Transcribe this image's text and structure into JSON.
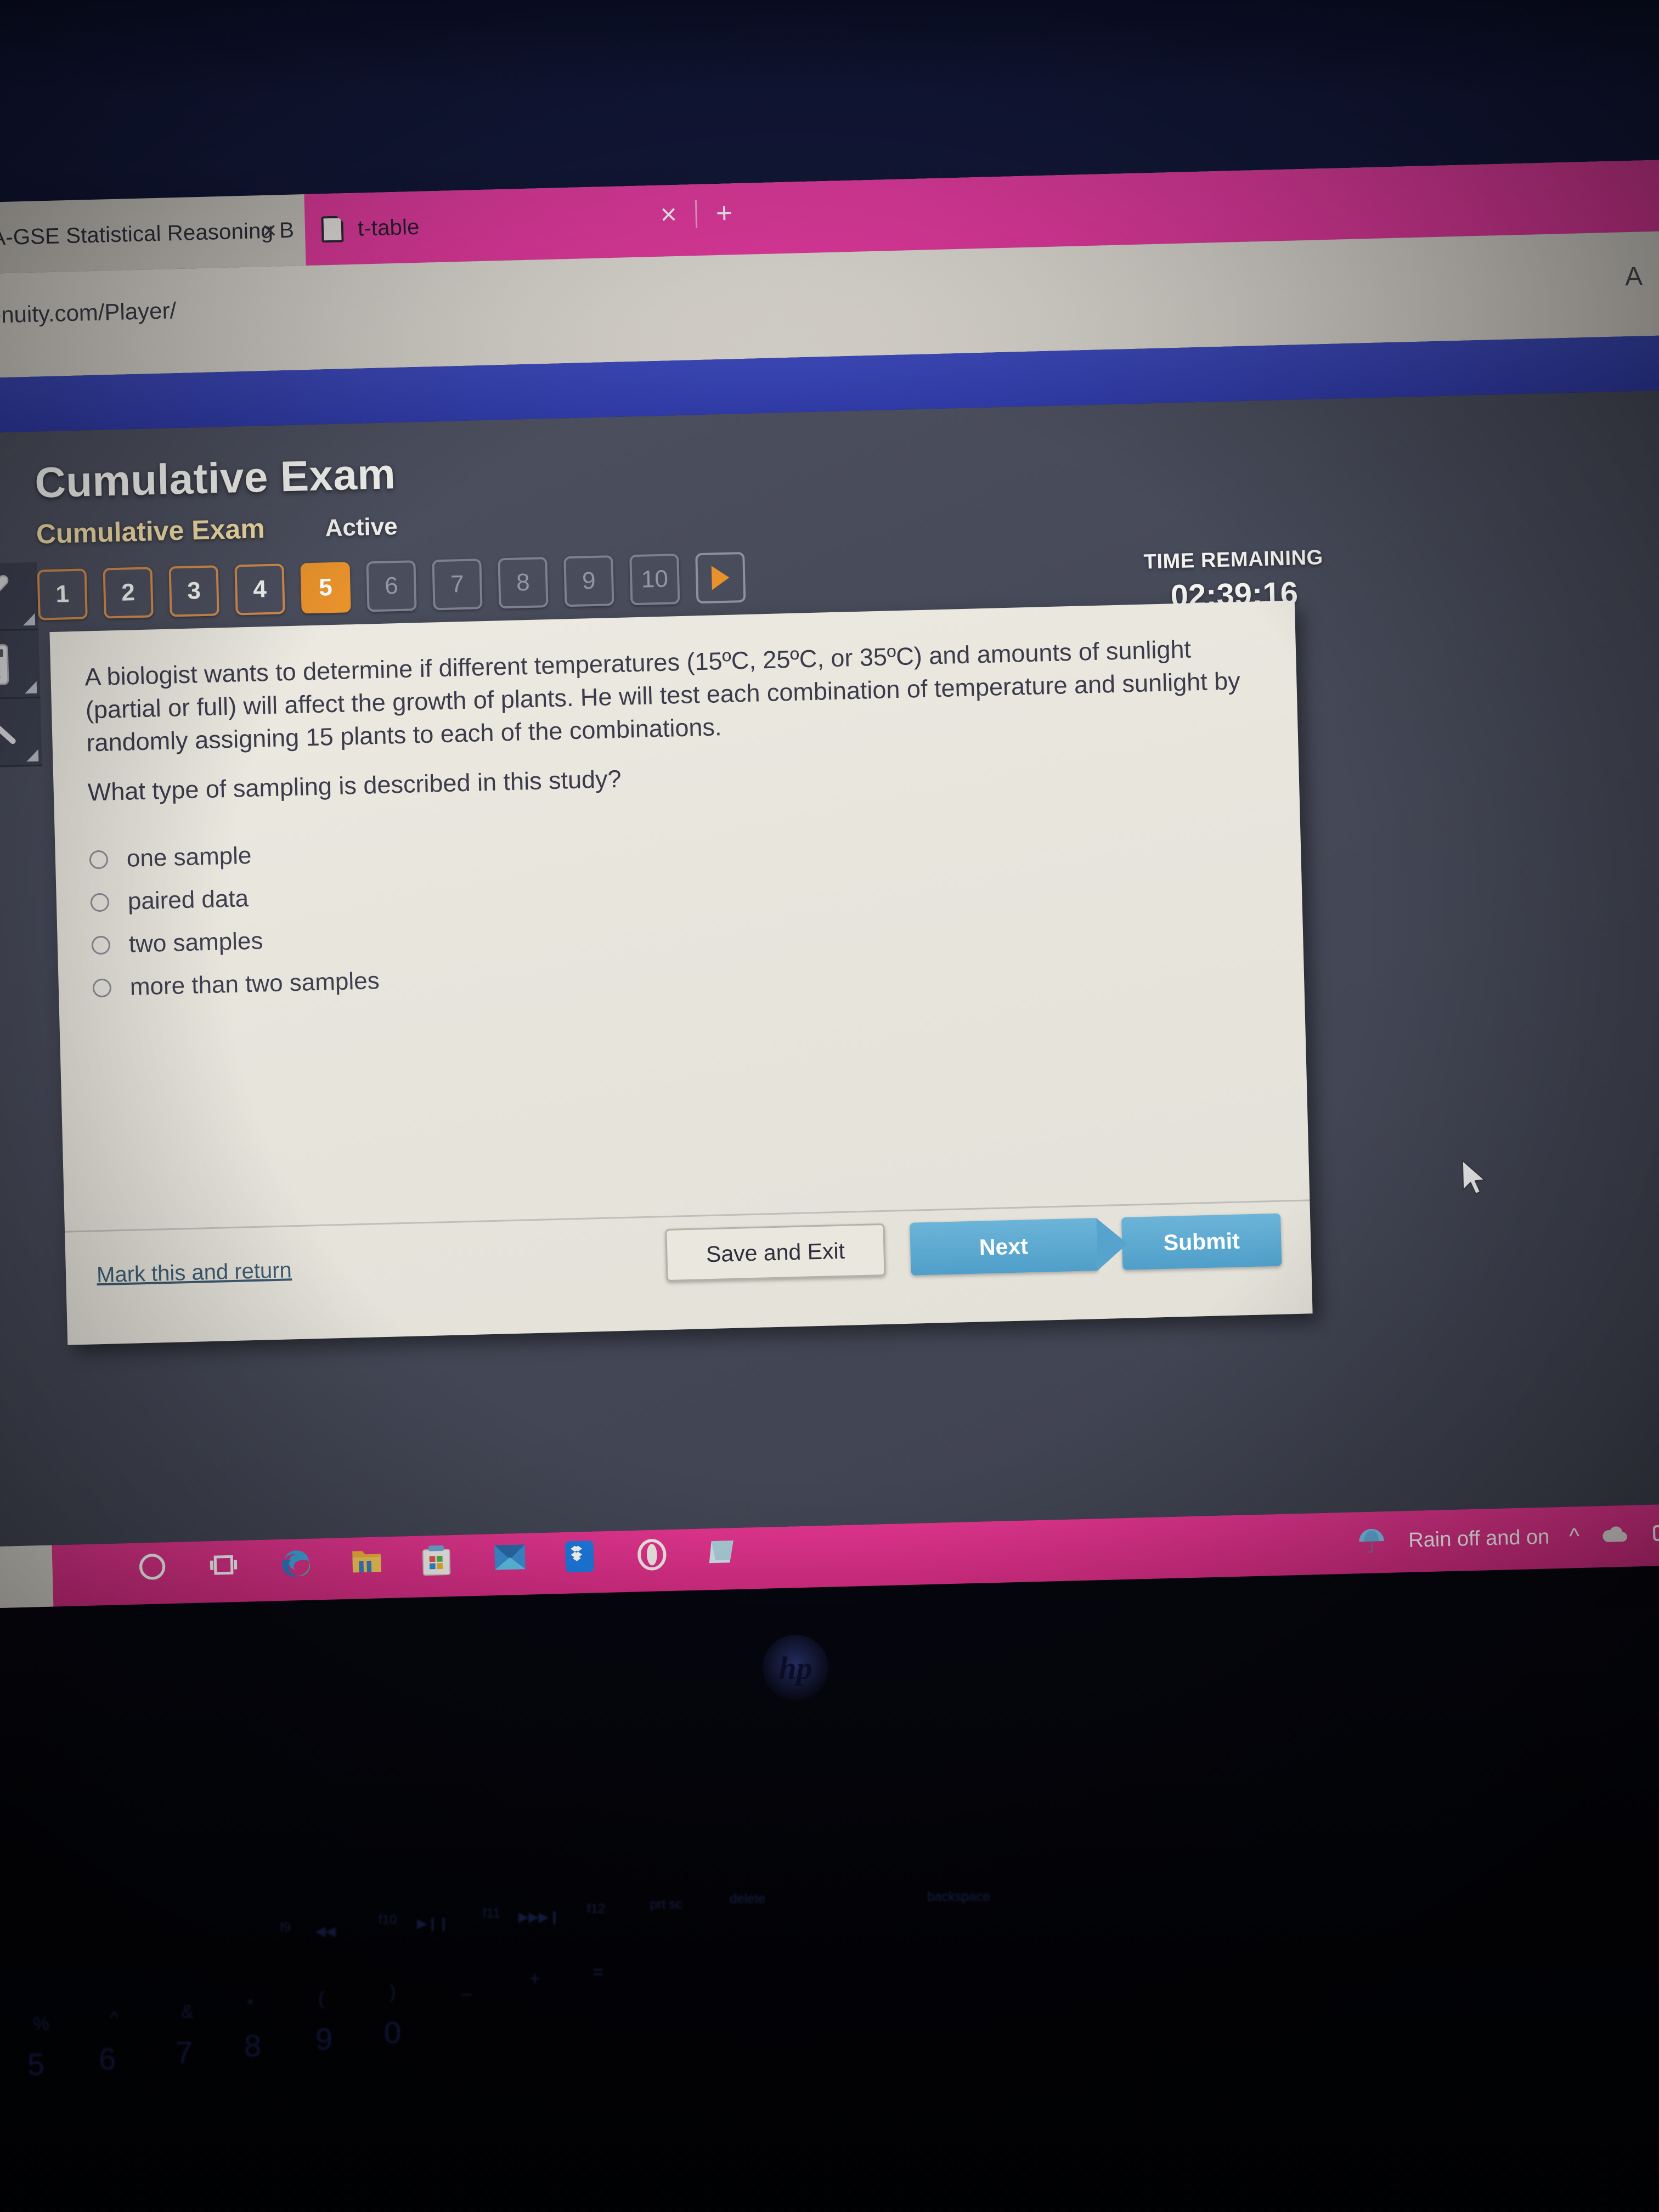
{
  "browser": {
    "tabs": [
      {
        "title": "GA-GSE Statistical Reasoning B",
        "favicon": "red-favicon",
        "active": false,
        "close_label": "×"
      },
      {
        "title": "t-table",
        "favicon": "document-icon",
        "active": true,
        "close_label": "×"
      }
    ],
    "new_tab_label": "+",
    "url": "rn.edgenuity.com/Player/",
    "toolbar_icons": [
      "read-aloud-icon",
      "favorites-star-icon"
    ],
    "read_aloud_glyph": "A",
    "favorites_glyph": "☆"
  },
  "exam": {
    "title": "Cumulative Exam",
    "lesson_label": "Cumulative Exam",
    "status_label": "Active"
  },
  "tools": [
    {
      "name": "highlighter-tool"
    },
    {
      "name": "calculator-tool"
    },
    {
      "name": "collapse-tool"
    }
  ],
  "pager": {
    "items": [
      {
        "label": "1",
        "state": "visited"
      },
      {
        "label": "2",
        "state": "visited"
      },
      {
        "label": "3",
        "state": "visited"
      },
      {
        "label": "4",
        "state": "visited"
      },
      {
        "label": "5",
        "state": "current"
      },
      {
        "label": "6",
        "state": "locked"
      },
      {
        "label": "7",
        "state": "locked"
      },
      {
        "label": "8",
        "state": "locked"
      },
      {
        "label": "9",
        "state": "locked"
      },
      {
        "label": "10",
        "state": "locked"
      }
    ],
    "next_page_icon": "play-arrow-icon"
  },
  "timer": {
    "label": "TIME REMAINING",
    "value": "02:39:16"
  },
  "question": {
    "stem": "A biologist wants to determine if different temperatures (15ºC, 25ºC, or 35ºC) and amounts of sunlight (partial or full) will affect the growth of plants. He will test each combination of temperature and sunlight by randomly assigning 15 plants to each of the combinations.",
    "prompt": "What type of sampling is described in this study?",
    "choices": [
      {
        "label": "one sample",
        "selected": false
      },
      {
        "label": "paired data",
        "selected": false
      },
      {
        "label": "two samples",
        "selected": false
      },
      {
        "label": "more than two samples",
        "selected": false
      }
    ]
  },
  "actions": {
    "mark_link": "Mark this and return",
    "save_and_exit": "Save and Exit",
    "next": "Next",
    "submit": "Submit"
  },
  "taskbar": {
    "icons": [
      "cortana-circle-icon",
      "task-view-icon",
      "microsoft-edge-icon",
      "file-explorer-icon",
      "microsoft-store-icon",
      "mail-icon",
      "dropbox-icon",
      "opera-gx-icon",
      "notepad-icon"
    ],
    "weather_text": "Rain off and on",
    "weather_icon": "umbrella-icon",
    "tray": [
      "show-hidden-icons-chevron",
      "onedrive-cloud-icon",
      "meet-now-icon",
      "battery-icon"
    ]
  },
  "hardware": {
    "brand_logo": "hp",
    "keyboard_keys": [
      "5",
      "6",
      "7",
      "8",
      "9",
      "0",
      "(",
      ")",
      "&",
      "*",
      "^",
      "%",
      "f9",
      "f10",
      "f11",
      "f12",
      "prt sc",
      "delete",
      "backspace"
    ]
  },
  "colors": {
    "tab_accent": "#ef3fa8",
    "taskbar": "#e3358f",
    "pager_current": "#e8922c",
    "pager_visited_border": "#cf8a4d",
    "button_blue": "#4f9fca",
    "lesson_gold": "#f0dca4",
    "link_blue": "#3d5b72",
    "page_bg": "#474a59",
    "card_bg": "#e7e5dc"
  }
}
